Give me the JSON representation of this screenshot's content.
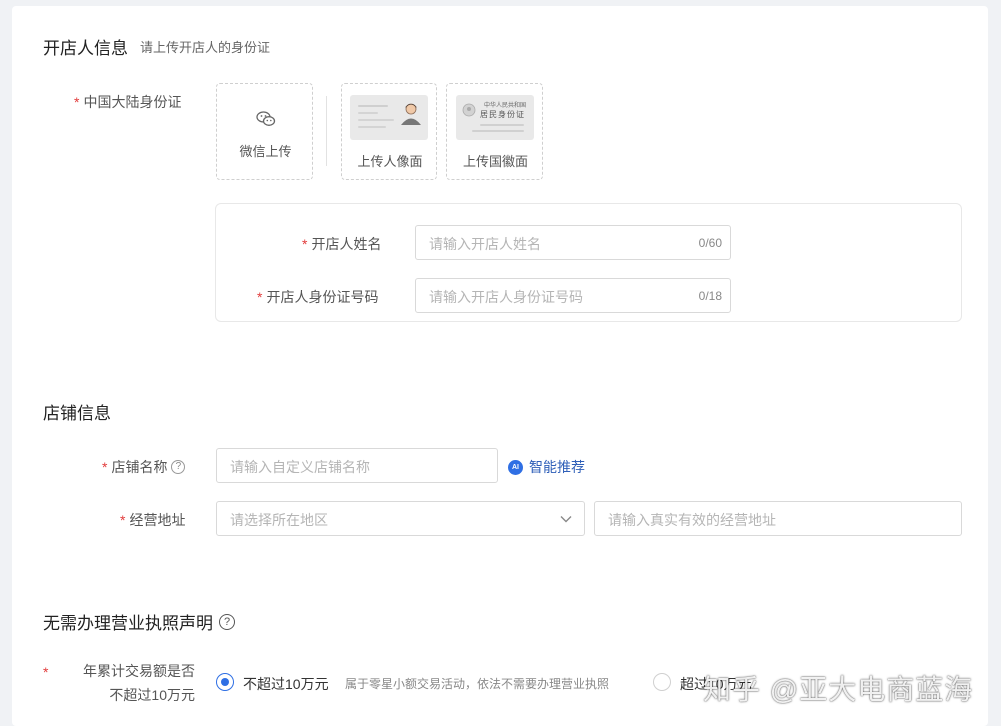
{
  "owner_section": {
    "title": "开店人信息",
    "subtitle": "请上传开店人的身份证",
    "id_label": "中国大陆身份证",
    "wechat_upload": "微信上传",
    "upload_portrait": "上传人像面",
    "upload_emblem": "上传国徽面",
    "emblem_card_line1": "中华人民共和国",
    "emblem_card_line2": "居民身份证",
    "name_label": "开店人姓名",
    "name_placeholder": "请输入开店人姓名",
    "name_count": "0/60",
    "idnum_label": "开店人身份证号码",
    "idnum_placeholder": "请输入开店人身份证号码",
    "idnum_count": "0/18"
  },
  "shop_section": {
    "title": "店铺信息",
    "name_label": "店铺名称",
    "name_help": "?",
    "name_placeholder": "请输入自定义店铺名称",
    "smart_badge": "AI",
    "smart_recommend": "智能推荐",
    "address_label": "经营地址",
    "region_placeholder": "请选择所在地区",
    "address_placeholder": "请输入真实有效的经营地址"
  },
  "license_section": {
    "title": "无需办理营业执照声明",
    "title_help": "?",
    "question_line1": "年累计交易额是否",
    "question_line2": "不超过10万元",
    "option1_label": "不超过10万元",
    "option1_desc": "属于零星小额交易活动，依法不需要办理营业执照",
    "option2_label": "超过10万元"
  },
  "required_mark": "*",
  "watermark": "知乎 @亚大电商蓝海",
  "colors": {
    "accent": "#2f6fe4",
    "required": "#e23b3b"
  }
}
